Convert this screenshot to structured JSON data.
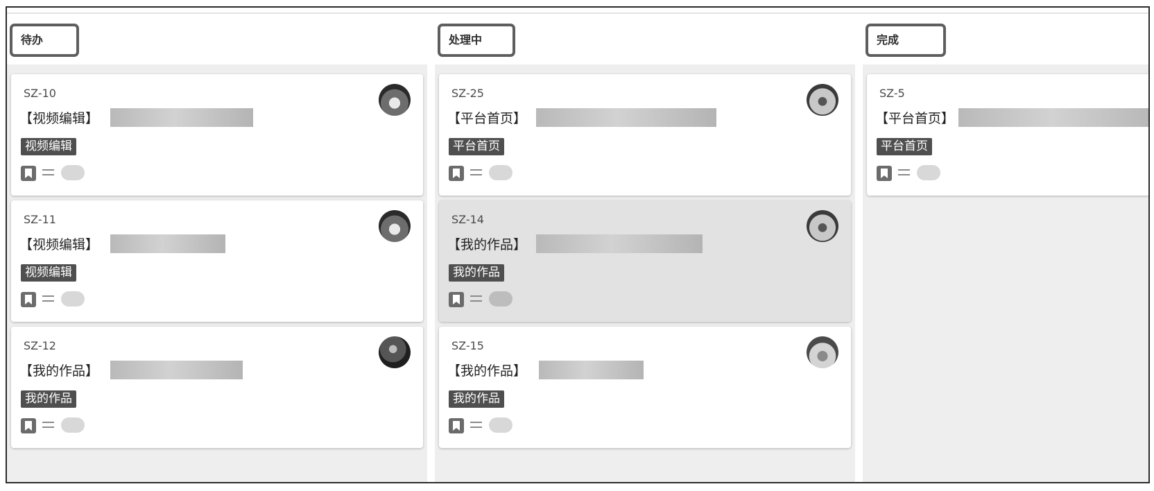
{
  "columns": [
    {
      "title": "待办",
      "cards": [
        {
          "id": "SZ-10",
          "title": "【视频编辑】",
          "tag": "视频编辑",
          "avatar": "dog-avatar"
        },
        {
          "id": "SZ-11",
          "title": "【视频编辑】",
          "tag": "视频编辑",
          "avatar": "dog-avatar"
        },
        {
          "id": "SZ-12",
          "title": "【我的作品】",
          "tag": "我的作品",
          "avatar": "dark-avatar"
        }
      ]
    },
    {
      "title": "处理中",
      "cards": [
        {
          "id": "SZ-25",
          "title": "【平台首页】",
          "tag": "平台首页",
          "avatar": "dog-avatar"
        },
        {
          "id": "SZ-14",
          "title": "【我的作品】",
          "tag": "我的作品",
          "avatar": "dog-avatar"
        },
        {
          "id": "SZ-15",
          "title": "【我的作品】",
          "tag": "我的作品",
          "avatar": "cat-avatar"
        }
      ]
    },
    {
      "title": "完成",
      "cards": [
        {
          "id": "SZ-5",
          "title": "【平台首页】",
          "tag": "平台首页",
          "avatar": "dog-avatar"
        }
      ]
    }
  ],
  "icons": {
    "bookmark": "bookmark-icon",
    "menu": "equals-icon",
    "status": "pill-toggle"
  },
  "colors": {
    "tag_bg": "#4f4f4f",
    "column_bg": "#eeeeee",
    "header_border": "#5e5e5e",
    "hover_card": "#e2e2e2"
  }
}
